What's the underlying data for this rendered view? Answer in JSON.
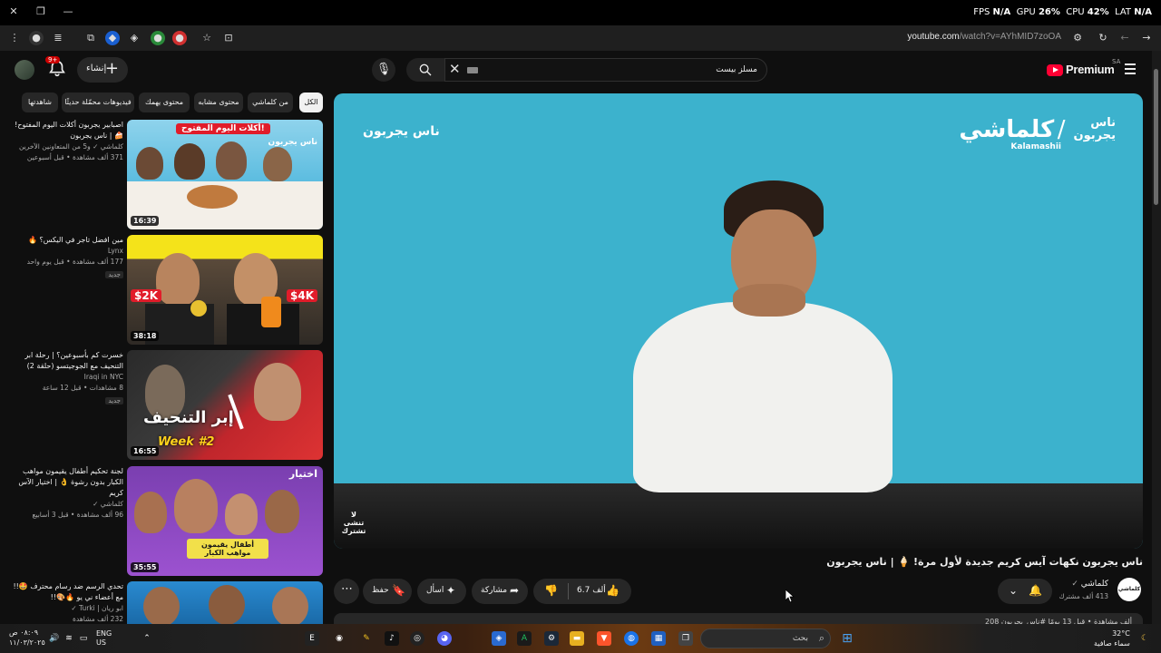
{
  "overlay": {
    "fps_label": "FPS",
    "fps_value": "N/A",
    "gpu_label": "GPU",
    "gpu_value": "26%",
    "cpu_label": "CPU",
    "cpu_value": "42%",
    "lat_label": "LAT",
    "lat_value": "N/A"
  },
  "browser": {
    "url_host": "youtube.com",
    "url_path": "/watch?v=AYhMID7zoOA"
  },
  "header": {
    "create_label": "إنشاء",
    "notification_count": "9+",
    "search_query": "مسلز بيست",
    "logo_text": "Premium",
    "country_code": "SA"
  },
  "chips": [
    {
      "label": "الكل",
      "active": true
    },
    {
      "label": "من كلماشي"
    },
    {
      "label": "محتوى مشابه"
    },
    {
      "label": "محتوى يهمك"
    },
    {
      "label": "فيديوهات محمّلة حديثًا"
    },
    {
      "label": "شاهدتها"
    }
  ],
  "sidebar_videos": [
    {
      "title": "اصبابير يجربون أكلات اليوم المفتوح! 🍰 | ناس يجربون",
      "channel": "كلماشي ✓ و5 من المتعاونين الآخرين",
      "views": "371 ألف مشاهدة • قبل أسبوعين",
      "duration": "16:39",
      "thumb_caption": "أكلات اليوم المفتوح!",
      "thumb_sub": "ناس يجربون",
      "badge": ""
    },
    {
      "title": "مين افضل تاجر في اليكس؟ 🔥",
      "channel": "Lynx",
      "views": "177 ألف مشاهدة • قبل يوم واحد",
      "duration": "38:18",
      "thumb_caption": "",
      "thumb_left_tag": "$2K",
      "thumb_right_tag": "$4K",
      "badge": "جديد"
    },
    {
      "title": "خسرت كم بأسبوعين؟ | رحلة ابر التنحيف مع الجوجيتسو (حلقة 2)",
      "channel": "Iraqi in NYC",
      "views": "8 مشاهدات • قبل 12 ساعة",
      "duration": "16:55",
      "thumb_caption": "إبر التنحيف",
      "thumb_sub": "Week #2",
      "badge": "جديد"
    },
    {
      "title": "لجنة تحكيم أطفال يقيمون مواهب الكبار بدون رشوة 👌 | اختيار الآس كريم",
      "channel": "كلماشي ✓",
      "views": "96 ألف مشاهدة • قبل 3 أسابيع",
      "duration": "35:55",
      "thumb_caption": "أطفال يقيمون مواهب الكبار",
      "thumb_sub": "اختيار",
      "badge": ""
    },
    {
      "title": "تحدي الرسم ضد رسام محترف 🤩!! مع أعضاء ني يو 🔥🎨!!",
      "channel": "ابو ريان | Turki ✓",
      "views": "232 ألف مشاهدة",
      "duration": "",
      "thumb_caption": "",
      "badge": ""
    }
  ],
  "player": {
    "overlay_title": "ناس يجربون",
    "brand_main": "كلماشي",
    "brand_latin": "Kalamashii",
    "brand_show": "ناس يجربون",
    "watermark": "لا تنشى تشترك"
  },
  "video": {
    "title": "ناس يجربون نكهات آيس كريم جديدة لأول مرة! 🍦 | ناس يجربون",
    "channel": "كلماشي",
    "subscribers": "413 ألف مشترك",
    "likes": "6.7 ألف",
    "share_label": "مشاركة",
    "ask_label": "اسأل",
    "save_label": "حفظ",
    "description_preview": "208 ألف مشاهدة • قبل 13 يومًا #ناس_يجربون"
  },
  "taskbar": {
    "time": "٠٨:٠٩ ص",
    "date": "١١/٠٣/٢٠٢٥",
    "lang_top": "ENG",
    "lang_bottom": "US",
    "search_placeholder": "بحث",
    "temperature": "32°C",
    "weather": "سماء صافية"
  },
  "colors": {
    "background": "#0f0f0f",
    "chip": "#272727",
    "brand_red": "#ff0033",
    "player_bg": "#3cb2cd"
  }
}
